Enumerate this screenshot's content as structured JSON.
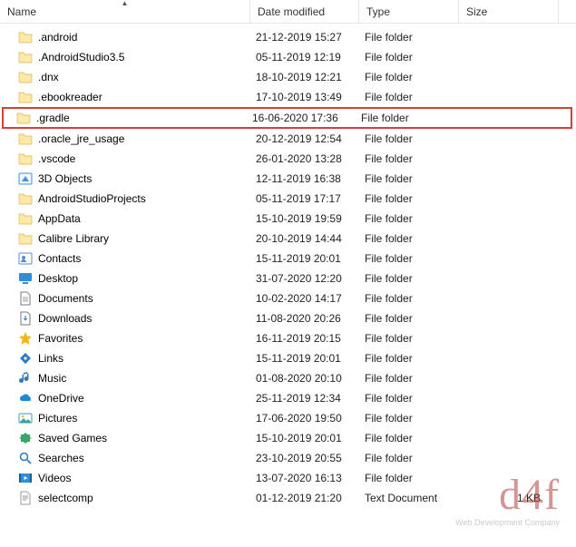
{
  "columns": {
    "name": "Name",
    "date": "Date modified",
    "type": "Type",
    "size": "Size"
  },
  "rows": [
    {
      "icon": "folder",
      "name": ".android",
      "date": "21-12-2019 15:27",
      "type": "File folder",
      "size": "",
      "highlight": false
    },
    {
      "icon": "folder",
      "name": ".AndroidStudio3.5",
      "date": "05-11-2019 12:19",
      "type": "File folder",
      "size": "",
      "highlight": false
    },
    {
      "icon": "folder",
      "name": ".dnx",
      "date": "18-10-2019 12:21",
      "type": "File folder",
      "size": "",
      "highlight": false
    },
    {
      "icon": "folder",
      "name": ".ebookreader",
      "date": "17-10-2019 13:49",
      "type": "File folder",
      "size": "",
      "highlight": false
    },
    {
      "icon": "folder",
      "name": ".gradle",
      "date": "16-06-2020 17:36",
      "type": "File folder",
      "size": "",
      "highlight": true
    },
    {
      "icon": "folder",
      "name": ".oracle_jre_usage",
      "date": "20-12-2019 12:54",
      "type": "File folder",
      "size": "",
      "highlight": false
    },
    {
      "icon": "folder",
      "name": ".vscode",
      "date": "26-01-2020 13:28",
      "type": "File folder",
      "size": "",
      "highlight": false
    },
    {
      "icon": "3dobjects",
      "name": "3D Objects",
      "date": "12-11-2019 16:38",
      "type": "File folder",
      "size": "",
      "highlight": false
    },
    {
      "icon": "folder",
      "name": "AndroidStudioProjects",
      "date": "05-11-2019 17:17",
      "type": "File folder",
      "size": "",
      "highlight": false
    },
    {
      "icon": "folder",
      "name": "AppData",
      "date": "15-10-2019 19:59",
      "type": "File folder",
      "size": "",
      "highlight": false
    },
    {
      "icon": "folder",
      "name": "Calibre Library",
      "date": "20-10-2019 14:44",
      "type": "File folder",
      "size": "",
      "highlight": false
    },
    {
      "icon": "contacts",
      "name": "Contacts",
      "date": "15-11-2019 20:01",
      "type": "File folder",
      "size": "",
      "highlight": false
    },
    {
      "icon": "desktop",
      "name": "Desktop",
      "date": "31-07-2020 12:20",
      "type": "File folder",
      "size": "",
      "highlight": false
    },
    {
      "icon": "documents",
      "name": "Documents",
      "date": "10-02-2020 14:17",
      "type": "File folder",
      "size": "",
      "highlight": false
    },
    {
      "icon": "downloads",
      "name": "Downloads",
      "date": "11-08-2020 20:26",
      "type": "File folder",
      "size": "",
      "highlight": false
    },
    {
      "icon": "favorites",
      "name": "Favorites",
      "date": "16-11-2019 20:15",
      "type": "File folder",
      "size": "",
      "highlight": false
    },
    {
      "icon": "links",
      "name": "Links",
      "date": "15-11-2019 20:01",
      "type": "File folder",
      "size": "",
      "highlight": false
    },
    {
      "icon": "music",
      "name": "Music",
      "date": "01-08-2020 20:10",
      "type": "File folder",
      "size": "",
      "highlight": false
    },
    {
      "icon": "onedrive",
      "name": "OneDrive",
      "date": "25-11-2019 12:34",
      "type": "File folder",
      "size": "",
      "highlight": false
    },
    {
      "icon": "pictures",
      "name": "Pictures",
      "date": "17-06-2020 19:50",
      "type": "File folder",
      "size": "",
      "highlight": false
    },
    {
      "icon": "savedgames",
      "name": "Saved Games",
      "date": "15-10-2019 20:01",
      "type": "File folder",
      "size": "",
      "highlight": false
    },
    {
      "icon": "searches",
      "name": "Searches",
      "date": "23-10-2019 20:55",
      "type": "File folder",
      "size": "",
      "highlight": false
    },
    {
      "icon": "videos",
      "name": "Videos",
      "date": "13-07-2020 16:13",
      "type": "File folder",
      "size": "",
      "highlight": false
    },
    {
      "icon": "textfile",
      "name": "selectcomp",
      "date": "01-12-2019 21:20",
      "type": "Text Document",
      "size": "1 KB",
      "highlight": false
    }
  ],
  "watermark": {
    "main": "d4f",
    "sub": "Web Development Company"
  }
}
